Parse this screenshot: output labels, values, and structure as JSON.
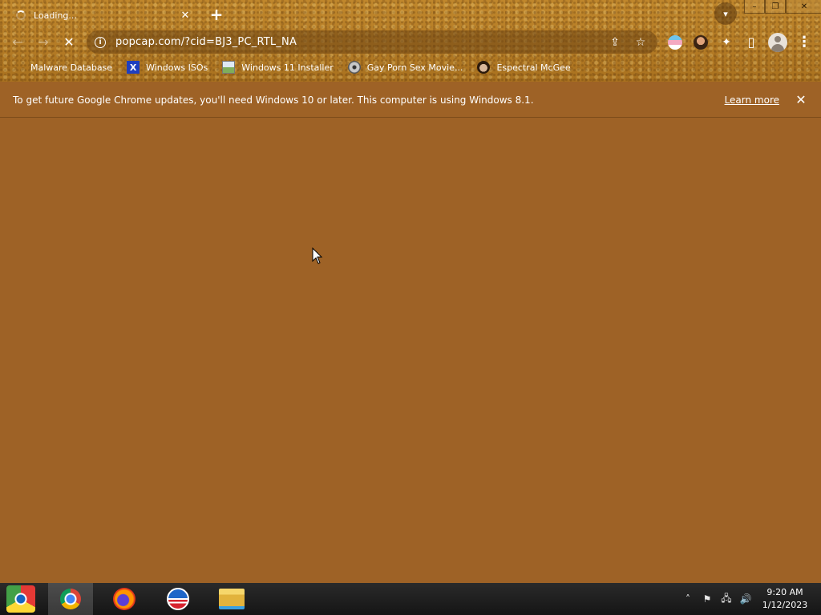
{
  "tab": {
    "title": "Loading...",
    "close_glyph": "✕",
    "new_tab_glyph": "+"
  },
  "window": {
    "minimize_glyph": "–",
    "restore_glyph": "❐",
    "close_glyph": "✕"
  },
  "toolbar": {
    "back_glyph": "←",
    "forward_glyph": "→",
    "stop_glyph": "✕",
    "url": "popcap.com/?cid=BJ3_PC_RTL_NA",
    "info_glyph": "i",
    "share_glyph": "⇪",
    "star_glyph": "☆",
    "extensions_glyph": "✦",
    "sidepanel_glyph": "▯",
    "menu_glyph": "⋮"
  },
  "bookmarks": [
    {
      "label": "Malware Database",
      "icon": "malware-icon"
    },
    {
      "label": "Windows ISOs",
      "icon": "x-icon",
      "glyph": "X"
    },
    {
      "label": "Windows 11 Installer",
      "icon": "image-icon"
    },
    {
      "label": "Gay Porn Sex Movie...",
      "icon": "disc-icon"
    },
    {
      "label": "Espectral McGee",
      "icon": "face-icon"
    }
  ],
  "infobar": {
    "message": "To get future Google Chrome updates, you'll need Windows 10 or later. This computer is using Windows 8.1.",
    "learn_more": "Learn more",
    "close_glyph": "✕"
  },
  "taskbar": {
    "apps": [
      "chrome",
      "firefox",
      "obama-badge",
      "file-explorer"
    ],
    "tray_chevron": "˄",
    "time": "9:20 AM",
    "date": "1/12/2023"
  },
  "colors": {
    "theme_brown": "#9e6226",
    "frame_sand": "#b77e27",
    "taskbar": "#1c1c1c"
  }
}
